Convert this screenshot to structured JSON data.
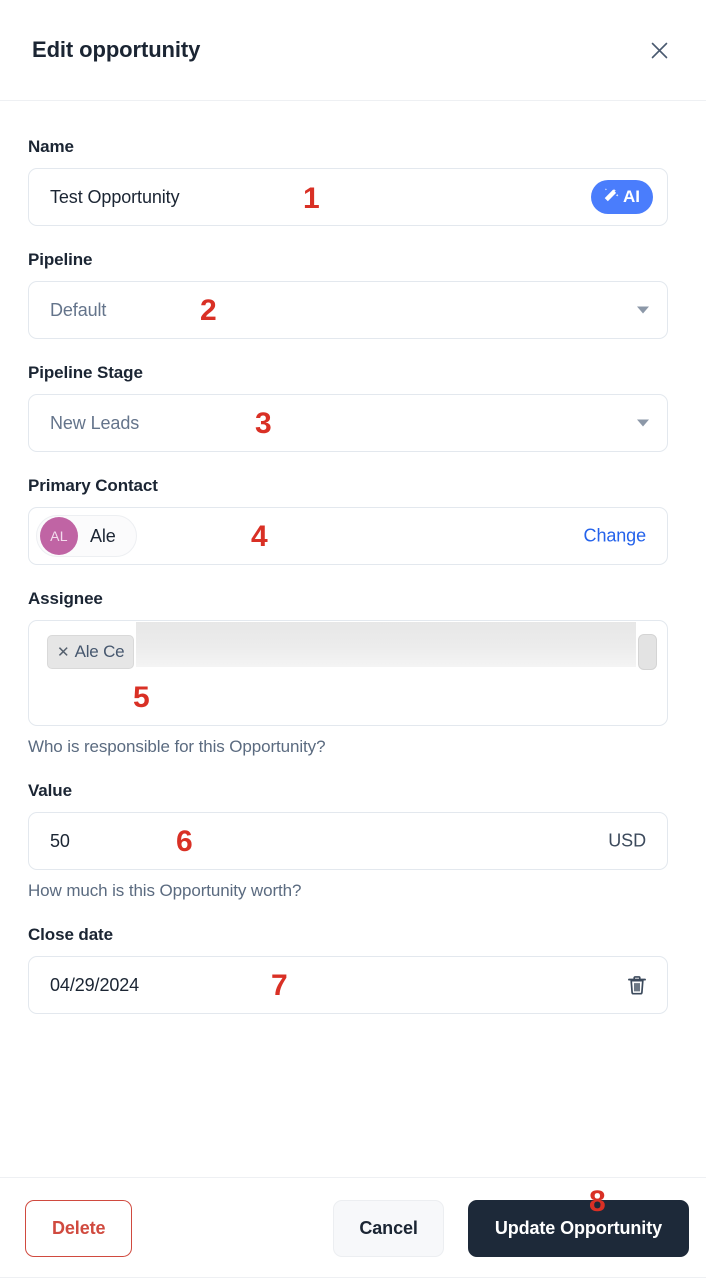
{
  "header": {
    "title": "Edit opportunity",
    "close_icon": "close-icon"
  },
  "fields": {
    "name": {
      "label": "Name",
      "value": "Test Opportunity",
      "ai_button_label": "AI",
      "ai_icon": "magic-wand-icon"
    },
    "pipeline": {
      "label": "Pipeline",
      "value": "Default",
      "caret_icon": "chevron-down-icon"
    },
    "pipeline_stage": {
      "label": "Pipeline Stage",
      "value": "New Leads",
      "caret_icon": "chevron-down-icon"
    },
    "primary_contact": {
      "label": "Primary Contact",
      "avatar_initials": "AL",
      "contact_name": "Ale",
      "change_label": "Change"
    },
    "assignee": {
      "label": "Assignee",
      "token_remove_icon": "remove-token-icon",
      "token_label": "Ale Ce",
      "help_text": "Who is responsible for this Opportunity?"
    },
    "value": {
      "label": "Value",
      "value": "50",
      "currency": "USD",
      "help_text": "How much is this Opportunity worth?"
    },
    "close_date": {
      "label": "Close date",
      "value": "04/29/2024",
      "clear_icon": "trash-icon"
    }
  },
  "footer": {
    "delete_label": "Delete",
    "cancel_label": "Cancel",
    "submit_label": "Update Opportunity"
  },
  "annotations": [
    {
      "number": "1"
    },
    {
      "number": "2"
    },
    {
      "number": "3"
    },
    {
      "number": "4"
    },
    {
      "number": "5"
    },
    {
      "number": "6"
    },
    {
      "number": "7"
    },
    {
      "number": "8"
    }
  ],
  "colors": {
    "accent_blue": "#4a7dfc",
    "link_blue": "#2563eb",
    "danger_red": "#d04a3f",
    "annotation_red": "#d93025",
    "primary_dark": "#1d2939",
    "avatar_pink": "#c064a4"
  }
}
